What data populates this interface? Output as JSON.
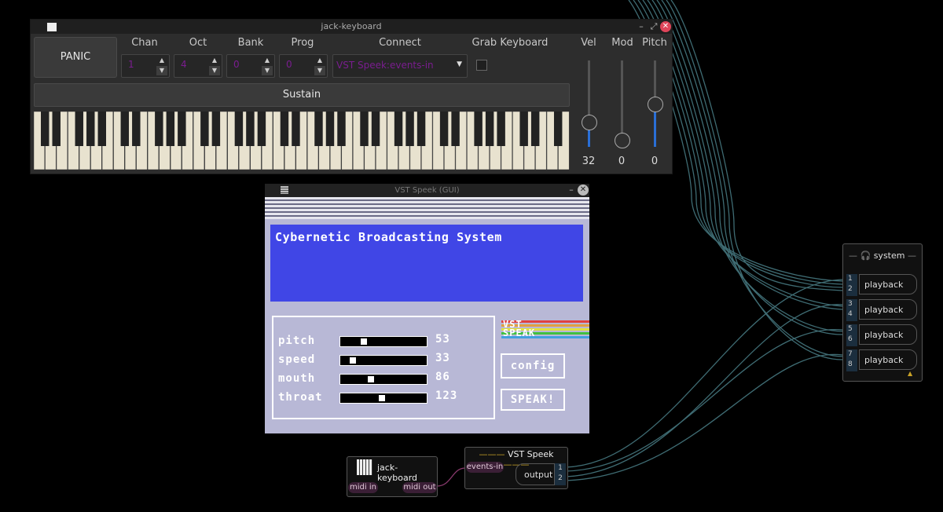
{
  "keyboard_window": {
    "title": "jack-keyboard",
    "panic_label": "PANIC",
    "headers": {
      "chan": "Chan",
      "oct": "Oct",
      "bank": "Bank",
      "prog": "Prog",
      "connect": "Connect",
      "grab": "Grab Keyboard",
      "vel": "Vel",
      "mod": "Mod",
      "pitch": "Pitch"
    },
    "chan_value": "1",
    "oct_value": "4",
    "bank_value": "0",
    "prog_value": "0",
    "connect_value": "VST Speek:events-in",
    "grab_checked": false,
    "sustain_label": "Sustain",
    "vel_value": "32",
    "mod_value": "0",
    "pitch_value": "0",
    "vel_level": 0.25,
    "mod_level": 0.0,
    "pitch_level": 0.5
  },
  "vst_window": {
    "title": "VST Speek (GUI)",
    "screen_text": "Cybernetic Broadcasting System",
    "params": [
      {
        "label": "pitch",
        "value": "53",
        "level": 0.24
      },
      {
        "label": "speed",
        "value": "33",
        "level": 0.1
      },
      {
        "label": "mouth",
        "value": "86",
        "level": 0.34
      },
      {
        "label": "throat",
        "value": "123",
        "level": 0.48
      }
    ],
    "logo_line1": "VST",
    "logo_line2": "SPEAK",
    "config_label": "config",
    "speak_label": "SPEAK!"
  },
  "patchbay": {
    "system_title": "system",
    "system_ports": [
      {
        "nums": [
          "1",
          "2"
        ],
        "label": "playback"
      },
      {
        "nums": [
          "3",
          "4"
        ],
        "label": "playback"
      },
      {
        "nums": [
          "5",
          "6"
        ],
        "label": "playback"
      },
      {
        "nums": [
          "7",
          "8"
        ],
        "label": "playback"
      }
    ],
    "jk_title": "jack-keyboard",
    "jk_midi_in": "midi in",
    "jk_midi_out": "midi out",
    "vs_title": "VST Speek",
    "vs_events_in": "events-in",
    "vs_output": "output",
    "vs_out_nums": [
      "1",
      "2"
    ]
  },
  "colors": {
    "accent": "#2a6fd6",
    "close": "#e0455a",
    "vst_screen": "#4046e6",
    "vst_bg": "#b8b8d6",
    "wire": "#4a7f88"
  }
}
